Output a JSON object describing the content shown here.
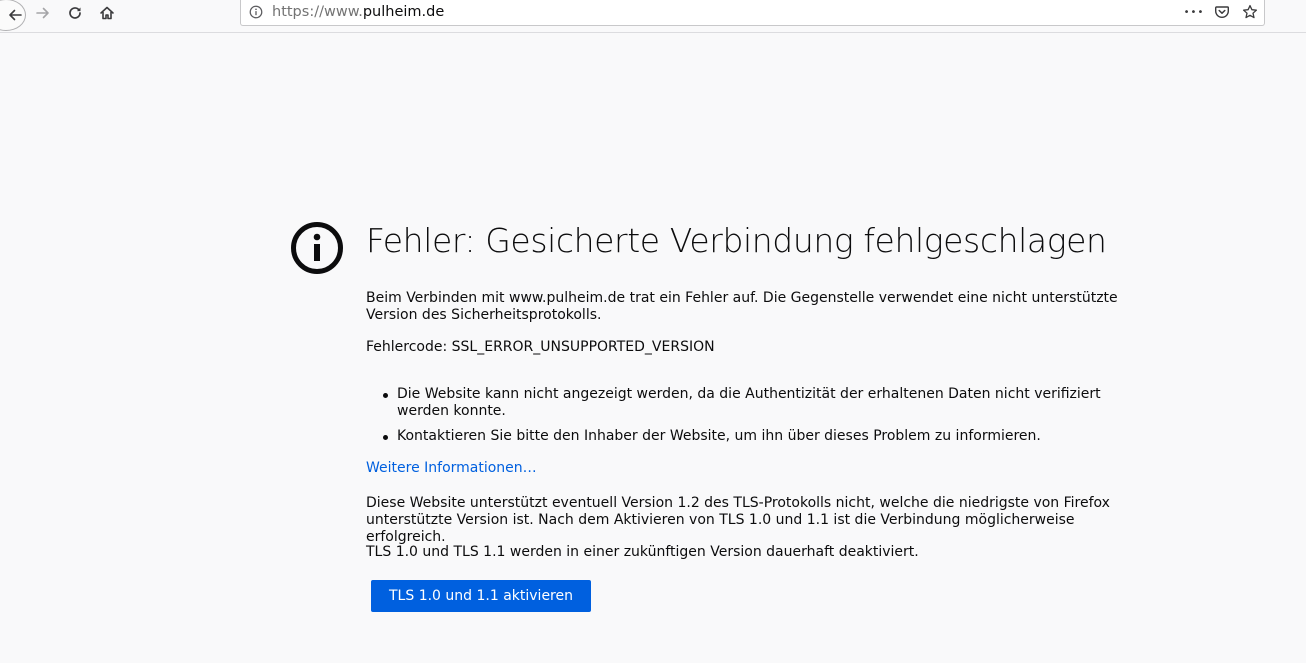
{
  "toolbar": {
    "url_scheme": "https://www.",
    "url_host": "pulheim.de",
    "page_actions_glyph": "•••"
  },
  "icons": {
    "back": "back-arrow-icon",
    "forward": "forward-arrow-icon",
    "reload": "reload-icon",
    "home": "home-icon",
    "site_info": "info-icon",
    "page_actions": "more-actions-icon",
    "pocket": "pocket-icon",
    "bookmark": "bookmark-star-icon",
    "error": "info-circle-icon"
  },
  "error": {
    "title": "Fehler: Gesicherte Verbindung fehlgeschlagen",
    "description": "Beim Verbinden mit www.pulheim.de trat ein Fehler auf. Die Gegenstelle verwendet eine nicht unterstützte Version des Sicherheitsprotokolls.",
    "code_line": "Fehlercode: SSL_ERROR_UNSUPPORTED_VERSION",
    "bullets": [
      "Die Website kann nicht angezeigt werden, da die Authentizität der erhaltenen Daten nicht verifiziert werden konnte.",
      "Kontaktieren Sie bitte den Inhaber der Website, um ihn über dieses Problem zu informieren."
    ],
    "more_info_link": "Weitere Informationen…",
    "tls_note": "Diese Website unterstützt eventuell Version 1.2 des TLS-Protokolls nicht, welche die niedrigste von Firefox unterstützte Version ist. Nach dem Aktivieren von TLS 1.0 und 1.1 ist die Verbindung möglicherweise erfolgreich.",
    "tls_deprecation": "TLS 1.0 und TLS 1.1 werden in einer zukünftigen Version dauerhaft deaktiviert.",
    "enable_button": "TLS 1.0 und 1.1 aktivieren"
  },
  "colors": {
    "page_background": "#f9f9fa",
    "link": "#0060df",
    "primary_button": "#0060df"
  }
}
